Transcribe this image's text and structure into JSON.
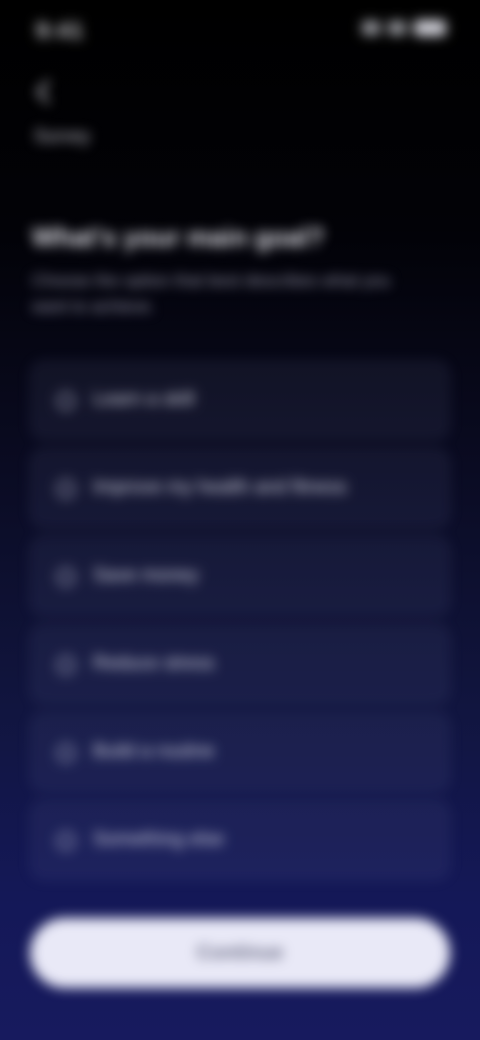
{
  "status_bar": {
    "time": "9:41"
  },
  "header": {
    "back_icon": "chevron-left-icon",
    "label": "Survey"
  },
  "question": {
    "title": "What's your main goal?",
    "subtitle": "Choose the option that best describes what you want to achieve."
  },
  "options": [
    {
      "label": "Learn a skill"
    },
    {
      "label": "Improve my health and fitness"
    },
    {
      "label": "Save money"
    },
    {
      "label": "Reduce stress"
    },
    {
      "label": "Build a routine"
    },
    {
      "label": "Something else"
    }
  ],
  "continue_label": "Continue",
  "colors": {
    "background_top": "#000000",
    "background_bottom": "#171a5e",
    "button_fill": "#e9e9f7"
  }
}
